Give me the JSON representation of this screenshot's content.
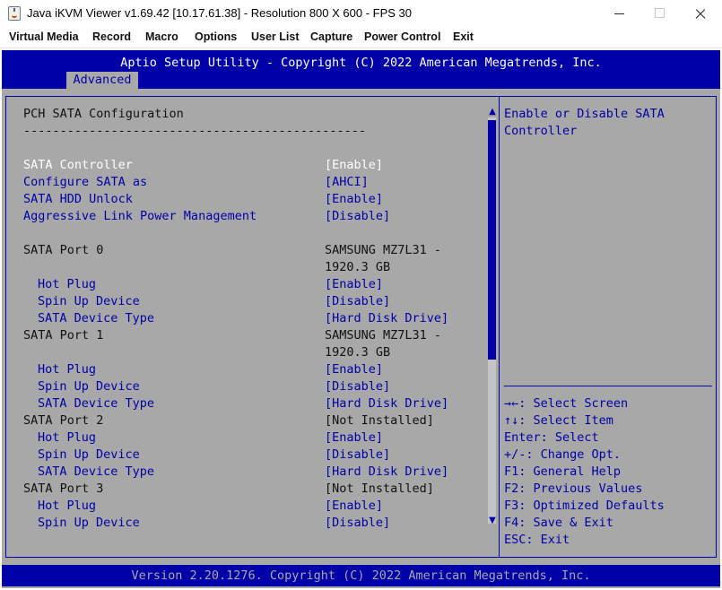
{
  "window": {
    "title": "Java iKVM Viewer v1.69.42 [10.17.61.38]  - Resolution 800 X 600 - FPS 30"
  },
  "menubar": {
    "items": [
      "Virtual Media",
      "Record",
      "Macro",
      "Options",
      "User List",
      "Capture",
      "Power Control",
      "Exit"
    ]
  },
  "bios": {
    "title": "Aptio Setup Utility - Copyright (C) 2022 American Megatrends, Inc.",
    "active_tab": "Advanced",
    "section_title": "PCH SATA Configuration",
    "separator": "-----------------------------------------------",
    "settings": [
      {
        "label": "SATA Controller",
        "value": "[Enable]"
      },
      {
        "label": "Configure SATA as",
        "value": "[AHCI]"
      },
      {
        "label": "SATA HDD Unlock",
        "value": "[Enable]"
      },
      {
        "label": "Aggressive Link Power Management",
        "value": "[Disable]"
      }
    ],
    "ports": [
      {
        "name": "SATA Port 0",
        "status_line1": "SAMSUNG MZ7L31 -",
        "status_line2": "1920.3 GB",
        "options": [
          {
            "label": "Hot Plug",
            "value": "[Enable]"
          },
          {
            "label": "Spin Up Device",
            "value": "[Disable]"
          },
          {
            "label": "SATA Device Type",
            "value": "[Hard Disk Drive]"
          }
        ]
      },
      {
        "name": "SATA Port 1",
        "status_line1": "SAMSUNG MZ7L31 -",
        "status_line2": "1920.3 GB",
        "options": [
          {
            "label": "Hot Plug",
            "value": "[Enable]"
          },
          {
            "label": "Spin Up Device",
            "value": "[Disable]"
          },
          {
            "label": "SATA Device Type",
            "value": "[Hard Disk Drive]"
          }
        ]
      },
      {
        "name": "SATA Port 2",
        "status_line1": "[Not Installed]",
        "options": [
          {
            "label": "Hot Plug",
            "value": "[Enable]"
          },
          {
            "label": "Spin Up Device",
            "value": "[Disable]"
          },
          {
            "label": "SATA Device Type",
            "value": "[Hard Disk Drive]"
          }
        ]
      },
      {
        "name": "SATA Port 3",
        "status_line1": "[Not Installed]",
        "options": [
          {
            "label": "Hot Plug",
            "value": "[Enable]"
          },
          {
            "label": "Spin Up Device",
            "value": "[Disable]"
          }
        ]
      }
    ],
    "help": {
      "line1": "Enable or Disable SATA",
      "line2": "Controller"
    },
    "keys": [
      "→←: Select Screen",
      "↑↓: Select Item",
      "Enter: Select",
      "+/-: Change Opt.",
      "F1: General Help",
      "F2: Previous Values",
      "F3: Optimized Defaults",
      "F4: Save & Exit",
      "ESC: Exit"
    ],
    "scroll_up_glyph": "▲",
    "scroll_down_glyph": "▼",
    "footer": "Version 2.20.1276. Copyright (C) 2022 American Megatrends, Inc."
  },
  "colors": {
    "bios_blue": "#0000a8",
    "bios_gray": "#a8a8a8",
    "highlight_white": "#ffffff"
  }
}
